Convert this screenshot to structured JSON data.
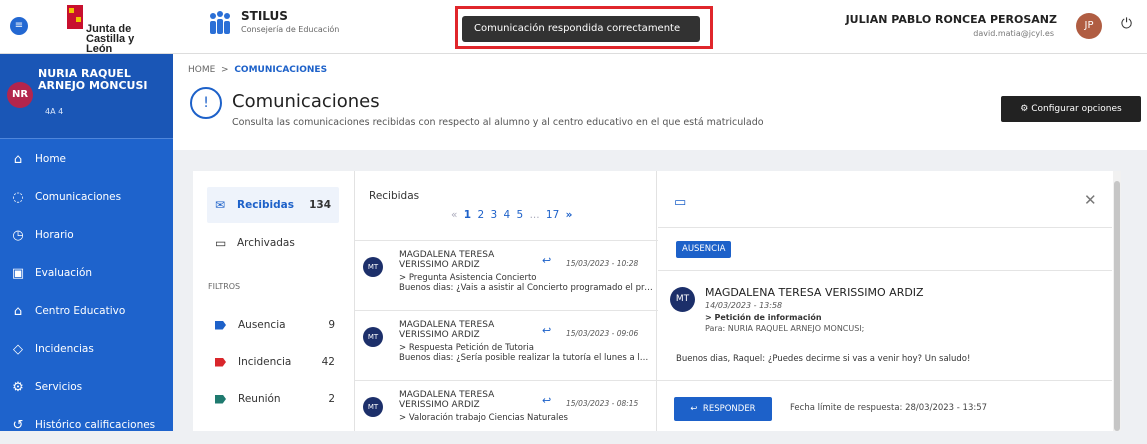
{
  "topbar": {
    "jcyl_line1": "Junta de",
    "jcyl_line2": "Castilla y León",
    "app_name": "STILUS",
    "app_sub": "Consejería de Educación",
    "toast": "Comunicación respondida correctamente",
    "user_name": "JULIAN PABLO RONCEA PEROSANZ",
    "user_email": "david.matia@jcyl.es",
    "user_initials": "JP"
  },
  "student": {
    "initials": "NR",
    "name": "NURIA RAQUEL ARNEJO MONCUSI",
    "group": "4A 4"
  },
  "nav": [
    {
      "label": "Home",
      "icon": "home-icon"
    },
    {
      "label": "Comunicaciones",
      "icon": "chat-icon"
    },
    {
      "label": "Horario",
      "icon": "clock-icon"
    },
    {
      "label": "Evaluación",
      "icon": "grade-icon"
    },
    {
      "label": "Centro Educativo",
      "icon": "school-icon"
    },
    {
      "label": "Incidencias",
      "icon": "incident-icon"
    },
    {
      "label": "Servicios",
      "icon": "gear-icon"
    },
    {
      "label": "Histórico calificaciones",
      "icon": "history-icon"
    }
  ],
  "header": {
    "breadcrumb_home": "HOME",
    "breadcrumb_sep": ">",
    "breadcrumb_current": "COMUNICACIONES",
    "title": "Comunicaciones",
    "subtitle": "Consulta las comunicaciones recibidas con respecto al alumno y al centro educativo en el que está matriculado",
    "config_label": "Configurar opciones"
  },
  "folders": {
    "inbox_label": "Recibidas",
    "inbox_count": "134",
    "archive_label": "Archivadas"
  },
  "filters": {
    "label": "FILTROS",
    "items": [
      {
        "label": "Ausencia",
        "count": "9",
        "color": "#1d61c9"
      },
      {
        "label": "Incidencia",
        "count": "42",
        "color": "#d9262b"
      },
      {
        "label": "Reunión",
        "count": "2",
        "color": "#1f7a6f"
      }
    ]
  },
  "list": {
    "title": "Recibidas",
    "pager": {
      "prev": "«",
      "pages": [
        "1",
        "2",
        "3",
        "4",
        "5"
      ],
      "ellipsis": "...",
      "last": "17",
      "next": "»"
    },
    "messages": [
      {
        "initials": "MT",
        "sender": "MAGDALENA TERESA VERISSIMO ARDIZ",
        "date": "15/03/2023 - 10:28",
        "subject": "> Pregunta Asistencia Concierto",
        "preview": "Buenos dias: ¿Vais a asistir al Concierto programado el próximo..."
      },
      {
        "initials": "MT",
        "sender": "MAGDALENA TERESA VERISSIMO ARDIZ",
        "date": "15/03/2023 - 09:06",
        "subject": "> Respuesta Petición de Tutoria",
        "preview": "Buenos dias: ¿Sería posible realizar la tutoría el lunes a las ..."
      },
      {
        "initials": "MT",
        "sender": "MAGDALENA TERESA VERISSIMO ARDIZ",
        "date": "15/03/2023 - 08:15",
        "subject": "> Valoración trabajo Ciencias Naturales",
        "preview": ""
      }
    ]
  },
  "detail": {
    "badge": "AUSENCIA",
    "initials": "MT",
    "sender": "MAGDALENA TERESA VERISSIMO ARDIZ",
    "date": "14/03/2023 - 13:58",
    "subject": "> Petición de información",
    "to": "Para: NURIA RAQUEL ARNEJO MONCUSI;",
    "body": "Buenos dias, Raquel: ¿Puedes decirme si vas a venir hoy? Un saludo!",
    "reply_label": "RESPONDER",
    "deadline": "Fecha límite de respuesta: 28/03/2023 - 13:57"
  }
}
